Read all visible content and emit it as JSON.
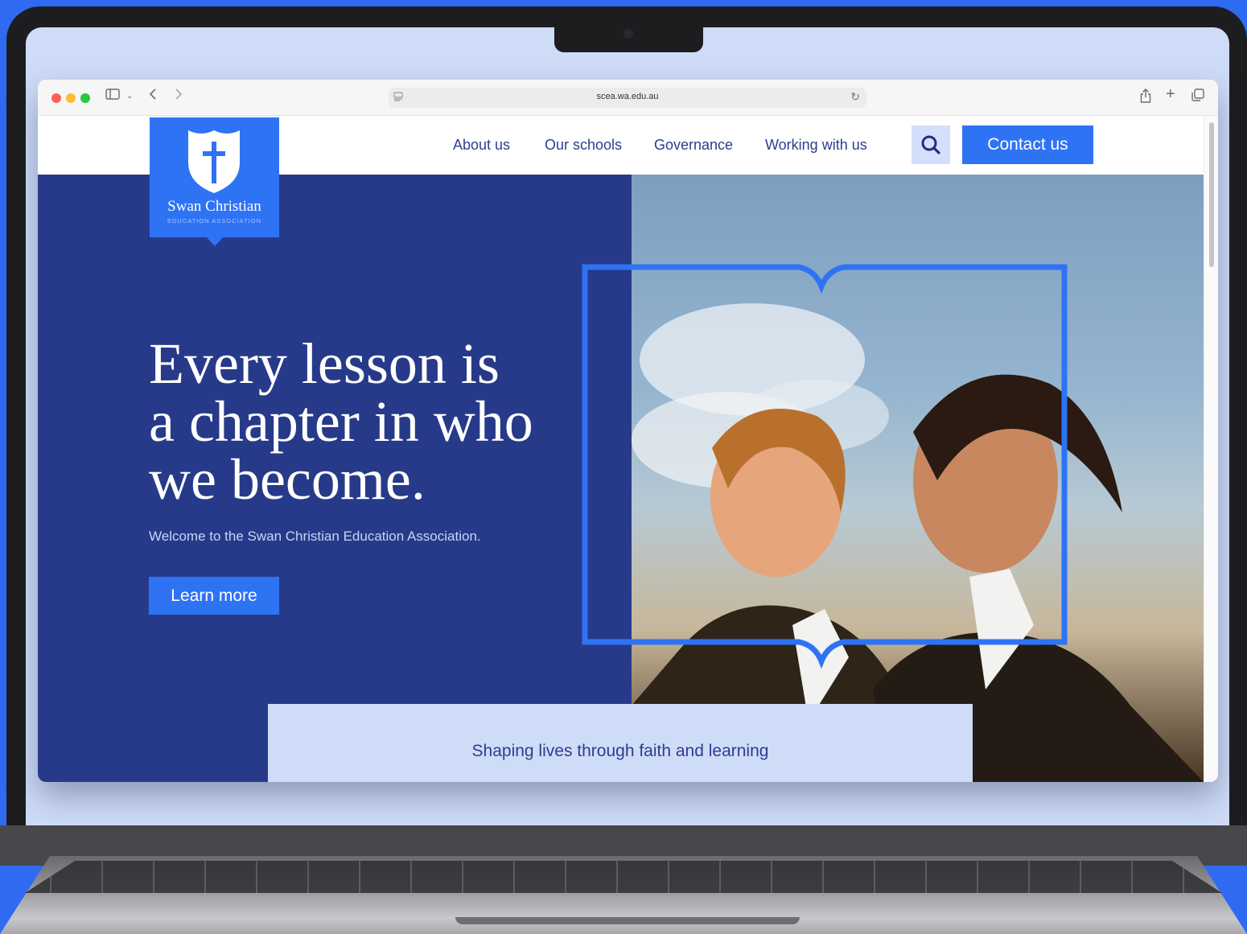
{
  "browser": {
    "url": "scea.wa.edu.au"
  },
  "site": {
    "logo": {
      "title": "Swan Christian",
      "subtitle": "EDUCATION ASSOCIATION"
    },
    "nav": [
      {
        "label": "About us"
      },
      {
        "label": "Our schools"
      },
      {
        "label": "Governance"
      },
      {
        "label": "Working with us"
      }
    ],
    "contact_label": "Contact us"
  },
  "hero": {
    "headline_line1": "Every lesson is",
    "headline_line2": "a chapter in who",
    "headline_line3": "we become.",
    "subtitle": "Welcome to the Swan Christian Education Association.",
    "cta_label": "Learn more"
  },
  "banner": {
    "text": "Shaping lives through faith and learning"
  },
  "icons": {
    "search": "search-icon",
    "sidebar": "sidebar-icon",
    "back": "chevron-left-icon",
    "forward": "chevron-right-icon",
    "share": "share-icon",
    "new_tab": "plus-icon",
    "tabs": "tabs-overview-icon",
    "reload": "reload-icon"
  },
  "colors": {
    "brand_blue": "#2f73f5",
    "navy": "#273a8a",
    "light_blue": "#cfdcf8",
    "page_background": "#2e6bf0"
  }
}
